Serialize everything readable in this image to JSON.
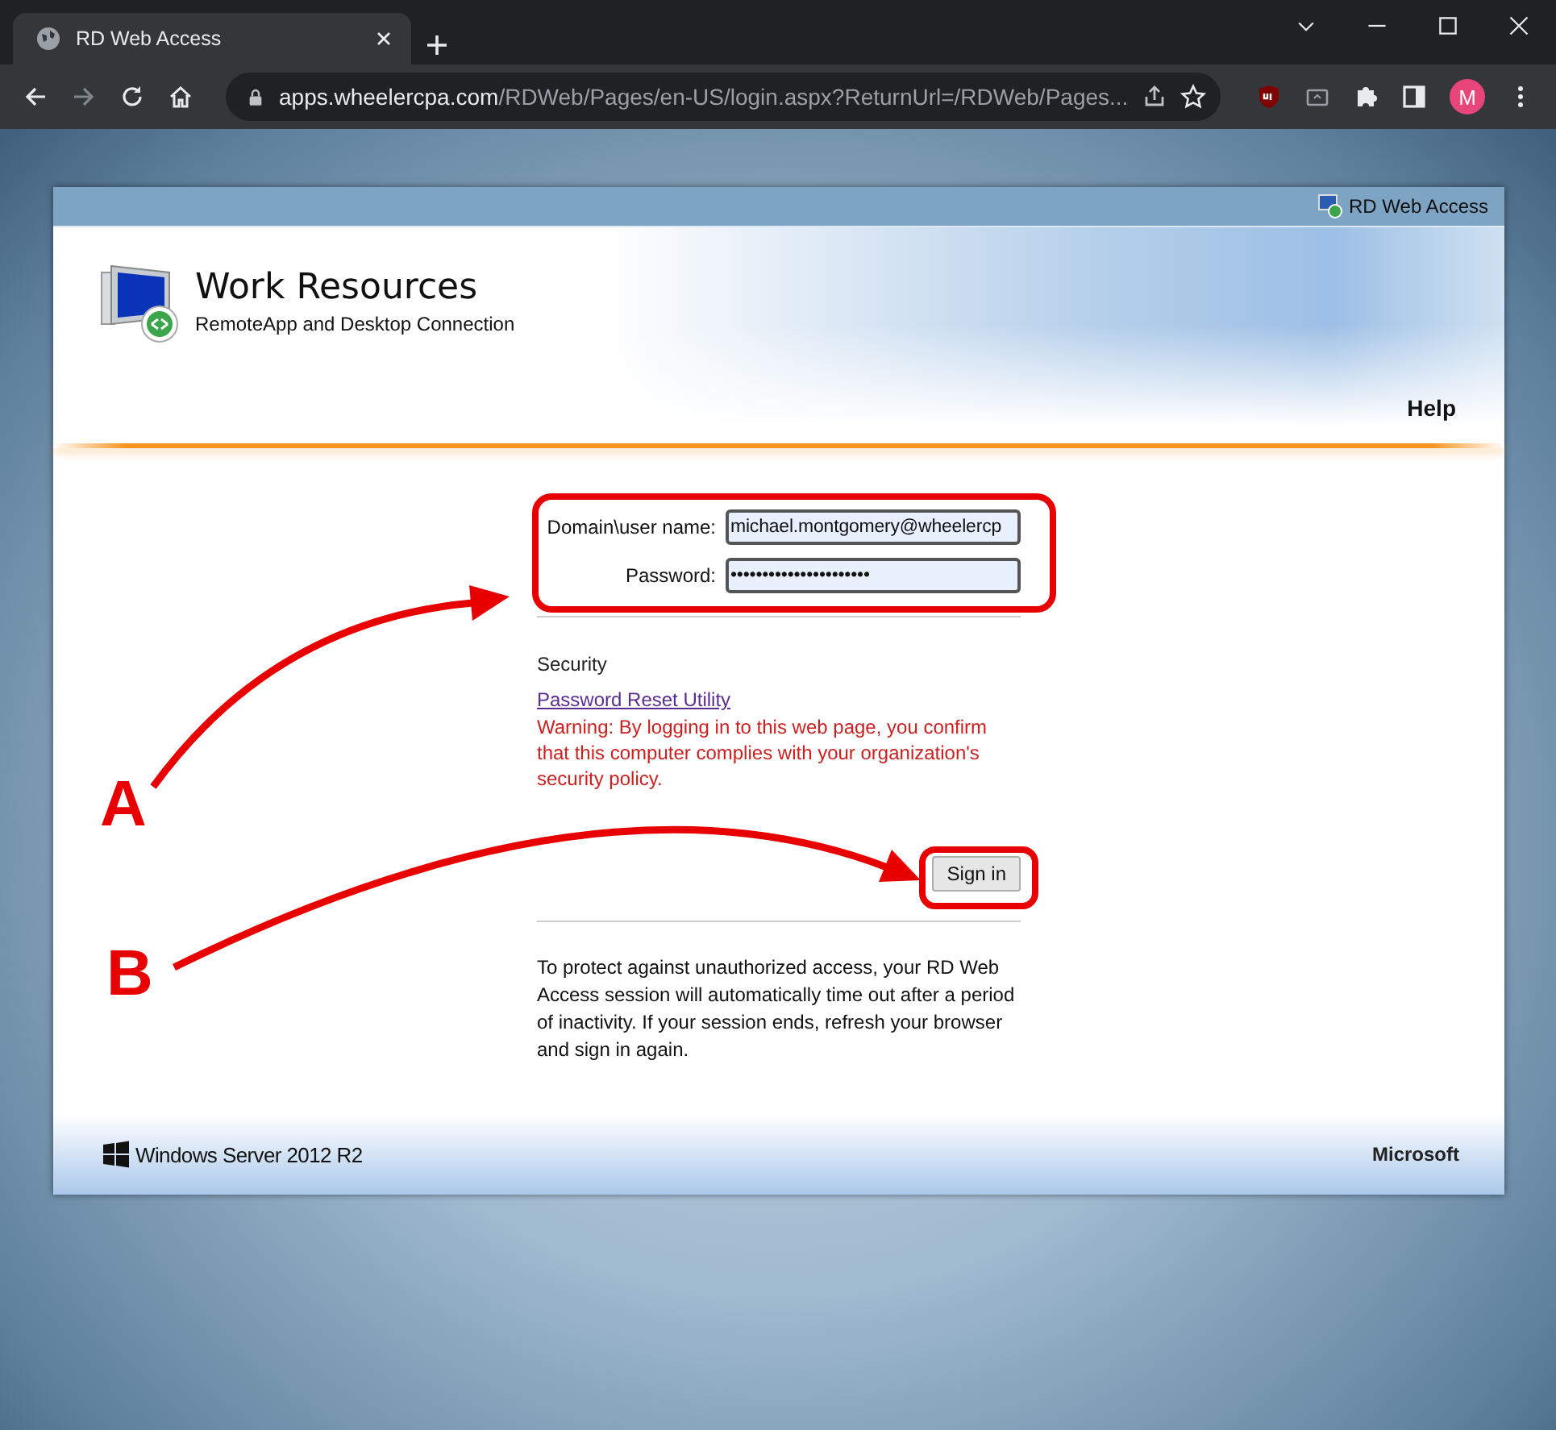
{
  "browser": {
    "tab": {
      "title": "RD Web Access"
    },
    "address_bar": {
      "host": "apps.wheelercpa.com",
      "path": "/RDWeb/Pages/en-US/login.aspx?ReturnUrl=/RDWeb/Pages..."
    },
    "profile": "M"
  },
  "page": {
    "top_bar": "RD Web Access",
    "title": "Work Resources",
    "subtitle": "RemoteApp and Desktop Connection",
    "help": "Help",
    "fields": [
      {
        "label": "Domain\\user name:",
        "value": "michael.montgomery@wheelercp"
      },
      {
        "label": "Password:",
        "value": "••••••••••••••••••••••"
      }
    ],
    "security_heading": "Security",
    "link": "Password Reset Utility",
    "warning": "Warning: By logging in to this web page, you confirm that this computer complies with your organization's security policy.",
    "sign_in": "Sign in",
    "notice": "To protect against unauthorized access, your RD Web Access session will automatically time out after a period of inactivity. If your session ends, refresh your browser and sign in again.",
    "footer": {
      "os": "Windows Server 2012 R2",
      "vendor": "Microsoft"
    }
  },
  "annotations": [
    {
      "label": "A"
    },
    {
      "label": "B"
    }
  ]
}
